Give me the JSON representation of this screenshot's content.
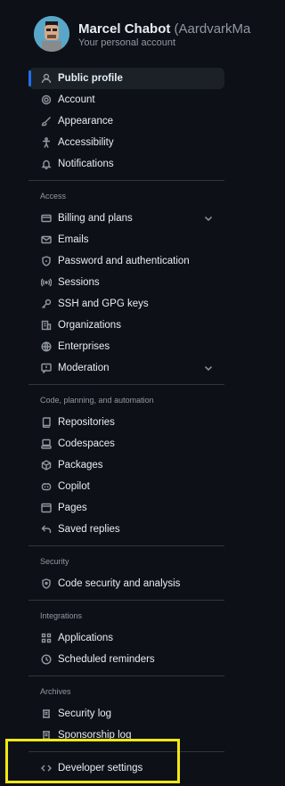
{
  "profile": {
    "name": "Marcel Chabot",
    "handle": "(AardvarkMa",
    "subtitle": "Your personal account"
  },
  "nav": {
    "top": [
      {
        "label": "Public profile",
        "icon": "person-icon",
        "active": true
      },
      {
        "label": "Account",
        "icon": "gear-icon"
      },
      {
        "label": "Appearance",
        "icon": "paintbrush-icon"
      },
      {
        "label": "Accessibility",
        "icon": "accessibility-icon"
      },
      {
        "label": "Notifications",
        "icon": "bell-icon"
      }
    ],
    "sections": [
      {
        "title": "Access",
        "items": [
          {
            "label": "Billing and plans",
            "icon": "credit-card-icon",
            "expandable": true
          },
          {
            "label": "Emails",
            "icon": "mail-icon"
          },
          {
            "label": "Password and authentication",
            "icon": "shield-lock-icon"
          },
          {
            "label": "Sessions",
            "icon": "broadcast-icon"
          },
          {
            "label": "SSH and GPG keys",
            "icon": "key-icon"
          },
          {
            "label": "Organizations",
            "icon": "organization-icon"
          },
          {
            "label": "Enterprises",
            "icon": "globe-icon"
          },
          {
            "label": "Moderation",
            "icon": "report-icon",
            "expandable": true
          }
        ]
      },
      {
        "title": "Code, planning, and automation",
        "items": [
          {
            "label": "Repositories",
            "icon": "repo-icon"
          },
          {
            "label": "Codespaces",
            "icon": "codespaces-icon"
          },
          {
            "label": "Packages",
            "icon": "package-icon"
          },
          {
            "label": "Copilot",
            "icon": "copilot-icon"
          },
          {
            "label": "Pages",
            "icon": "browser-icon"
          },
          {
            "label": "Saved replies",
            "icon": "reply-icon"
          }
        ]
      },
      {
        "title": "Security",
        "items": [
          {
            "label": "Code security and analysis",
            "icon": "shield-icon"
          }
        ]
      },
      {
        "title": "Integrations",
        "items": [
          {
            "label": "Applications",
            "icon": "apps-icon"
          },
          {
            "label": "Scheduled reminders",
            "icon": "clock-icon"
          }
        ]
      },
      {
        "title": "Archives",
        "items": [
          {
            "label": "Security log",
            "icon": "log-icon"
          },
          {
            "label": "Sponsorship log",
            "icon": "log-icon"
          }
        ]
      }
    ],
    "bottom": [
      {
        "label": "Developer settings",
        "icon": "code-icon"
      }
    ]
  },
  "colors": {
    "background": "#0d1117",
    "accent": "#1f6feb",
    "highlight": "#f2e813"
  }
}
